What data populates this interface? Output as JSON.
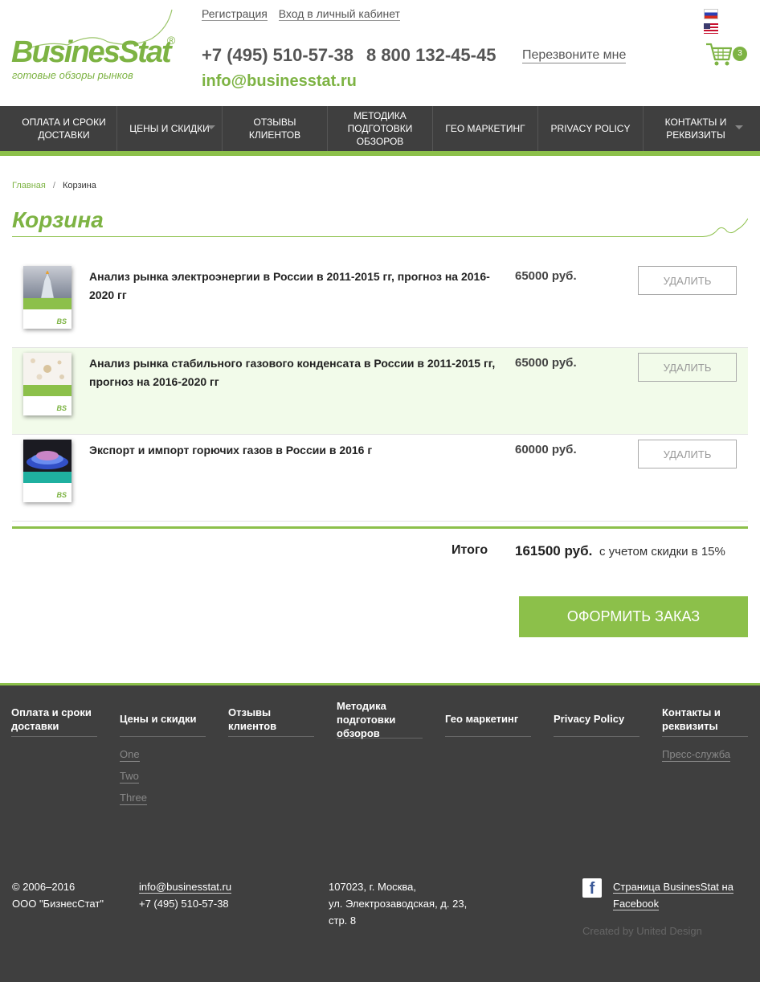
{
  "header": {
    "logo_text": "BusinesStat",
    "logo_reg": "®",
    "logo_tagline": "готовые обзоры рынков",
    "register_link": "Регистрация",
    "login_link": "Вход в личный кабинет",
    "phone1": "+7 (495) 510-57-38",
    "phone2": "8 800 132-45-45",
    "callback_link": "Перезвоните мне",
    "email": "info@businesstat.ru",
    "cart_count": "3",
    "lang_flags": [
      "ru-flag-icon",
      "us-flag-icon"
    ]
  },
  "nav": {
    "items": [
      {
        "label": "ОПЛАТА И СРОКИ ДОСТАВКИ"
      },
      {
        "label": "ЦЕНЫ И СКИДКИ"
      },
      {
        "label": "ОТЗЫВЫ КЛИЕНТОВ"
      },
      {
        "label": "МЕТОДИКА ПОДГОТОВКИ ОБЗОРОВ"
      },
      {
        "label": "ГЕО МАРКЕТИНГ"
      },
      {
        "label": "PRIVACY POLICY"
      },
      {
        "label": "КОНТАКТЫ И РЕКВИЗИТЫ"
      }
    ]
  },
  "breadcrumb": {
    "home": "Главная",
    "separator": "/",
    "current": "Корзина"
  },
  "page_title": "Корзина",
  "cart": {
    "items": [
      {
        "title": "Анализ рынка электроэнергии в России в 2011-2015 гг, прогноз на 2016-2020 гг",
        "price": "65000 руб.",
        "delete_label": "УДАЛИТЬ"
      },
      {
        "title": "Анализ рынка стабильного газового конденсата в России в 2011-2015 гг, прогноз на 2016-2020 гг",
        "price": "65000 руб.",
        "delete_label": "УДАЛИТЬ"
      },
      {
        "title": "Экспорт и импорт горючих газов в России в 2016 г",
        "price": "60000 руб.",
        "delete_label": "УДАЛИТЬ"
      }
    ],
    "thumb_logo": "BS",
    "total_label": "Итого",
    "total_value": "161500 руб.",
    "total_note": "с учетом скидки в 15%",
    "order_button": "ОФОРМИТЬ ЗАКАЗ"
  },
  "footer": {
    "columns": [
      {
        "title": "Оплата и сроки доставки",
        "links": []
      },
      {
        "title": "Цены и скидки",
        "links": [
          "One",
          "Two",
          "Three"
        ]
      },
      {
        "title": "Отзывы клиентов",
        "links": []
      },
      {
        "title": "Методика подготовки обзоров",
        "links": []
      },
      {
        "title": "Гео маркетинг",
        "links": []
      },
      {
        "title": "Privacy Policy",
        "links": []
      },
      {
        "title": "Контакты и реквизиты",
        "links": [
          "Пресс-служба"
        ]
      }
    ],
    "copyright": "© 2006–2016",
    "company": "ООО \"БизнесСтат\"",
    "email": "info@businesstat.ru",
    "phone": "+7 (495) 510-57-38",
    "address_line1": "107023, г. Москва,",
    "address_line2": "ул. Электрозаводская, д. 23,",
    "address_line3": "стр. 8",
    "facebook_icon": "facebook-icon",
    "facebook_link": "Страница BusinesStat на Facebook",
    "credit": "Created by United Design"
  },
  "colors": {
    "brand_green": "#7db343",
    "accent_green": "#8cc04a",
    "dark_bg": "#3f3f3f",
    "highlight_row": "#f2fbea"
  }
}
